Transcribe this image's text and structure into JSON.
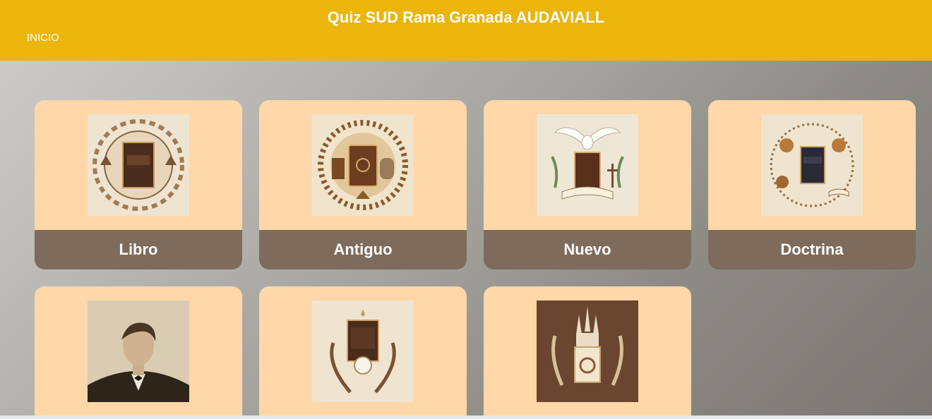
{
  "header": {
    "title": "Quiz SUD Rama Granada AUDAVIALL",
    "nav": [
      {
        "label": "INICIO"
      }
    ]
  },
  "cards": [
    {
      "label": "Libro",
      "image": "book-of-mormon-illustration"
    },
    {
      "label": "Antiguo",
      "image": "old-testament-illustration"
    },
    {
      "label": "Nuevo",
      "image": "new-testament-illustration"
    },
    {
      "label": "Doctrina",
      "image": "doctrine-and-covenants-illustration"
    },
    {
      "image": "portrait-illustration"
    },
    {
      "image": "pearl-of-great-price-illustration"
    },
    {
      "image": "temple-book-illustration"
    }
  ],
  "colors": {
    "header_bg": "#ebb50c",
    "card_bg": "#ffd7a8",
    "label_bar": "#7e6b5c",
    "text_light": "#ffffff"
  }
}
